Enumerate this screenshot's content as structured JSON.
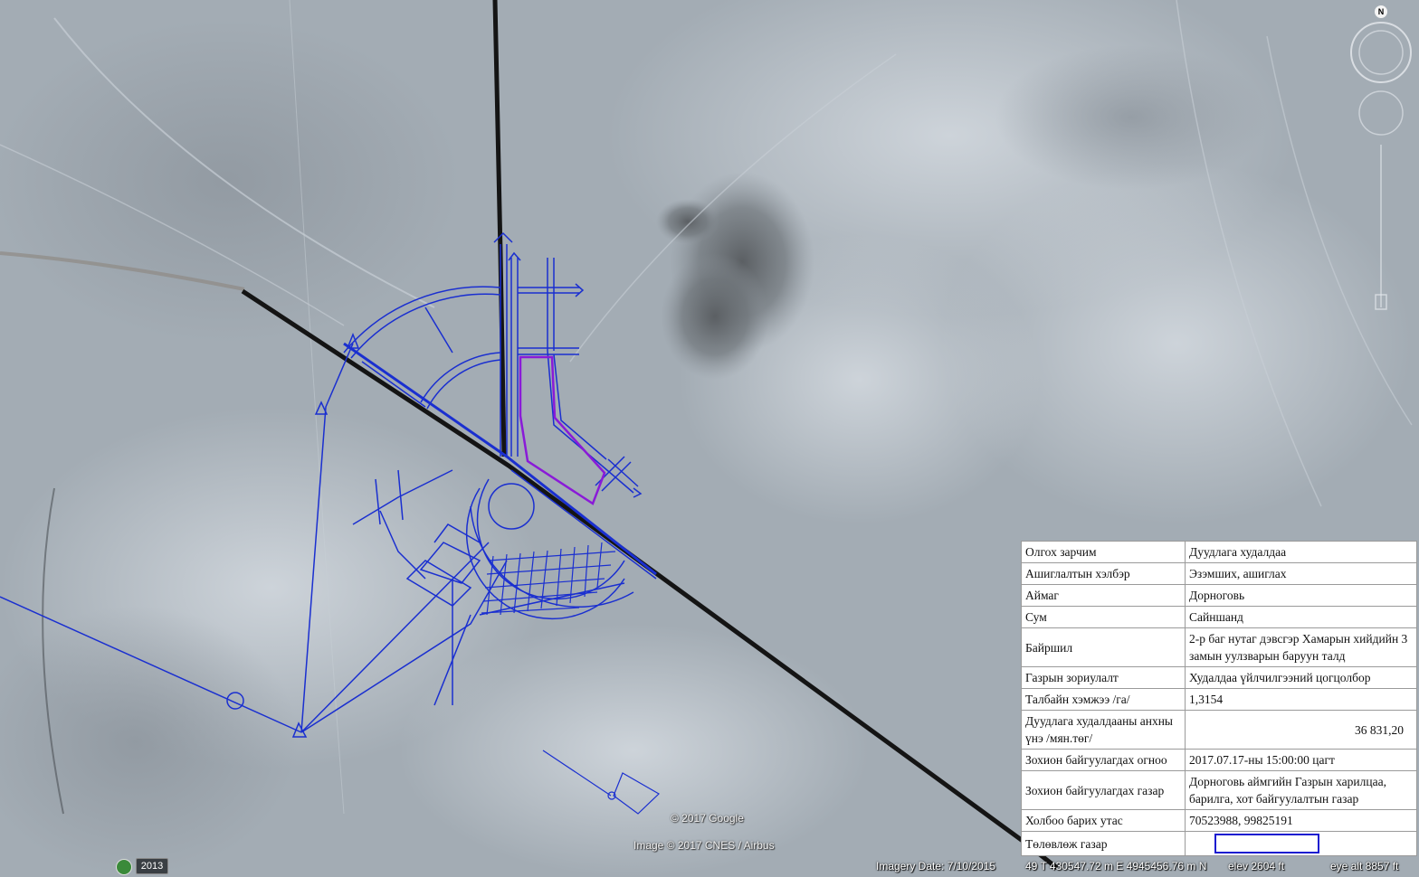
{
  "map": {
    "compass_label": "N",
    "copyright_google": "© 2017 Google",
    "copyright_imagery": "Image © 2017 CNES / Airbus",
    "year_badge": "2013",
    "status": {
      "imagery_date": "Imagery Date: 7/10/2015",
      "coords": "49 T 430547.72 m E 4945456.76 m N",
      "elev": "elev 2604 ft",
      "eye_alt": "eye alt 8857 ft"
    },
    "colors": {
      "road": "#141414",
      "plan_lines": "#1a2fd0",
      "highlight_parcel": "#8a1ad8",
      "terrain": "#a7b0b8"
    }
  },
  "info": {
    "rows": [
      {
        "key": "Олгох зарчим",
        "value": "Дуудлага худалдаа"
      },
      {
        "key": "Ашиглалтын хэлбэр",
        "value": "Эзэмших, ашиглах"
      },
      {
        "key": "Аймаг",
        "value": "Дорноговь"
      },
      {
        "key": "Сум",
        "value": "Сайншанд"
      },
      {
        "key": "Байршил",
        "value": "2-р баг нутаг дэвсгэр Хамарын хийдийн 3 замын уулзварын баруун талд"
      },
      {
        "key": "Газрын зориулалт",
        "value": "Худалдаа үйлчилгээний цогцолбор"
      },
      {
        "key": "Талбайн хэмжээ /га/",
        "value": "1,3154"
      },
      {
        "key": "Дуудлага худалдааны анхны үнэ /мян.төг/",
        "value": "36 831,20"
      },
      {
        "key": "Зохион байгуулагдах огноо",
        "value": "2017.07.17-ны 15:00:00 цагт"
      },
      {
        "key": "Зохион байгуулагдах газар",
        "value": "Дорноговь аймгийн Газрын харилцаа, барилга, хот байгуулалтын газар"
      },
      {
        "key": "Холбоо барих утас",
        "value": "70523988, 99825191"
      },
      {
        "key": "Төлөвлөж газар",
        "value": ""
      }
    ]
  }
}
